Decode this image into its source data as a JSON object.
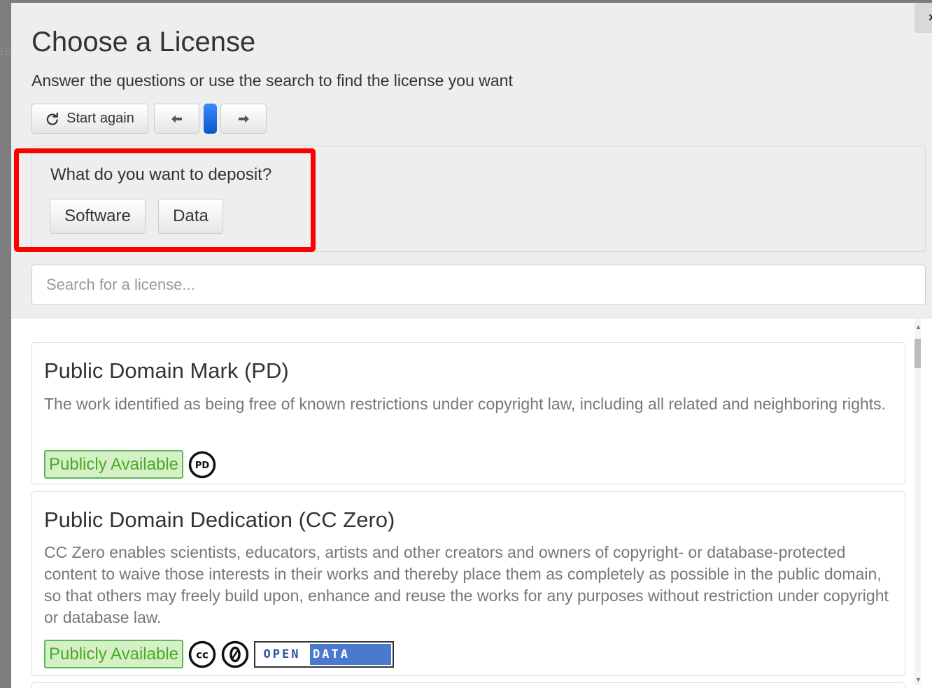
{
  "background": {
    "partial_text": "se"
  },
  "modal": {
    "close_glyph": "×",
    "title": "Choose a License",
    "subtitle": "Answer the questions or use the search to find the license you want"
  },
  "toolbar": {
    "start_again_label": "Start again",
    "prev_icon": "arrow-left-icon",
    "next_icon": "arrow-right-icon"
  },
  "question": {
    "text": "What do you want to deposit?",
    "options": [
      "Software",
      "Data"
    ]
  },
  "search": {
    "placeholder": "Search for a license..."
  },
  "licenses": [
    {
      "title": "Public Domain Mark (PD)",
      "description": "The work identified as being free of known restrictions under copyright law, including all related and neighboring rights.",
      "availability": "Publicly Available",
      "icons": [
        "pd-icon"
      ]
    },
    {
      "title": "Public Domain Dedication (CC Zero)",
      "description": "CC Zero enables scientists, educators, artists and other creators and owners of copyright- or database-protected content to waive those interests in their works and thereby place them as completely as possible in the public domain, so that others may freely build upon, enhance and reuse the works for any purposes without restriction under copyright or database law.",
      "availability": "Publicly Available",
      "icons": [
        "cc-icon",
        "zero-icon",
        "open-data-badge"
      ],
      "open_data_badge": {
        "left": "OPEN",
        "right": "DATA"
      }
    }
  ],
  "colors": {
    "header_bg": "#eeeeee",
    "highlight": "#ff0000",
    "badge_text": "#4aa82a",
    "badge_bg": "#d4f0c4",
    "progress": "#1a6cf0"
  }
}
